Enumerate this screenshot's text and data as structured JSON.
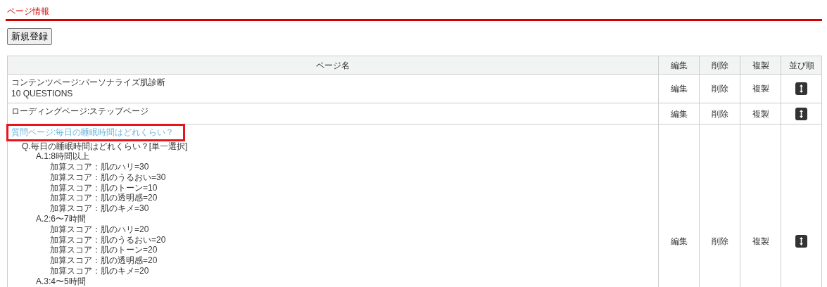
{
  "heading": "ページ情報",
  "new_button": "新規登録",
  "table": {
    "columns": [
      "ページ名",
      "編集",
      "削除",
      "複製",
      "並び順"
    ],
    "rows": [
      {
        "title": "コンテンツページ:パーソナライズ肌診断",
        "subtitle": "10 QUESTIONS",
        "link": false,
        "highlighted": false,
        "edit": "編集",
        "delete": "削除",
        "copy": "複製"
      },
      {
        "title": "ローディングページ:ステップページ",
        "link": false,
        "highlighted": false,
        "edit": "編集",
        "delete": "削除",
        "copy": "複製"
      },
      {
        "title": "質問ページ:毎日の睡眠時間はどれくらい？",
        "link": true,
        "highlighted": true,
        "edit": "編集",
        "delete": "削除",
        "copy": "複製",
        "tree": [
          {
            "text": "Q.毎日の睡眠時間はどれくらい？[単一選択]",
            "children": [
              {
                "text": "A.1:8時間以上",
                "children": [
                  {
                    "text": "加算スコア：肌のハリ=30"
                  },
                  {
                    "text": "加算スコア：肌のうるおい=30"
                  },
                  {
                    "text": "加算スコア：肌のトーン=10"
                  },
                  {
                    "text": "加算スコア：肌の透明感=20"
                  },
                  {
                    "text": "加算スコア：肌のキメ=30"
                  }
                ]
              },
              {
                "text": "A.2:6〜7時間",
                "children": [
                  {
                    "text": "加算スコア：肌のハリ=20"
                  },
                  {
                    "text": "加算スコア：肌のうるおい=20"
                  },
                  {
                    "text": "加算スコア：肌のトーン=20"
                  },
                  {
                    "text": "加算スコア：肌の透明感=20"
                  },
                  {
                    "text": "加算スコア：肌のキメ=20"
                  }
                ]
              },
              {
                "text": "A.3:4〜5時間"
              }
            ]
          }
        ]
      }
    ]
  }
}
